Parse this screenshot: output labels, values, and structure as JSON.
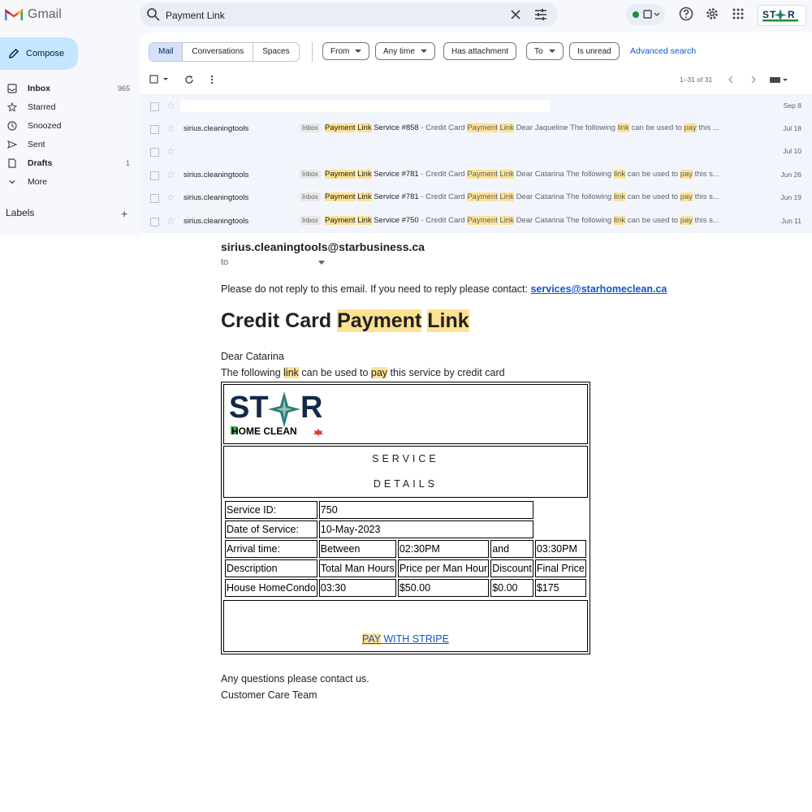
{
  "colors": {
    "accent": "#0b57d0",
    "compose_bg": "#c2e7ff",
    "highlight": "#fde293",
    "sidebar_bg": "#f6f8fc"
  },
  "header": {
    "app_name": "Gmail",
    "search_value": "Payment Link",
    "icons": [
      "search-icon",
      "close-icon",
      "tune-icon",
      "status-dot-icon",
      "help-icon",
      "gear-icon",
      "apps-icon"
    ]
  },
  "sidebar": {
    "compose_label": "Compose",
    "items": [
      {
        "label": "Inbox",
        "count": "965",
        "icon": "inbox-icon"
      },
      {
        "label": "Starred",
        "count": "",
        "icon": "star-icon"
      },
      {
        "label": "Snoozed",
        "count": "",
        "icon": "clock-icon"
      },
      {
        "label": "Sent",
        "count": "",
        "icon": "send-icon"
      },
      {
        "label": "Drafts",
        "count": "1",
        "icon": "draft-icon"
      },
      {
        "label": "More",
        "count": "",
        "icon": "chevron-down-icon"
      }
    ],
    "labels_title": "Labels"
  },
  "filters": {
    "segments": [
      "Mail",
      "Conversations",
      "Spaces"
    ],
    "chips": [
      "From",
      "Any time",
      "Has attachment",
      "To",
      "Is unread"
    ],
    "advanced_label": "Advanced search"
  },
  "toolbar": {
    "pager_text": "1–31 of 31"
  },
  "rows": [
    {
      "sender": "",
      "tag": "",
      "date": "Sep 8"
    },
    {
      "sender": "sirius.cleaningtools",
      "tag": "Inbox",
      "num": "#858",
      "name": "Jaqueline",
      "date": "Jul 18"
    },
    {
      "sender": "",
      "tag": "",
      "date": "Jul 10"
    },
    {
      "sender": "sirius.cleaningtools",
      "tag": "Inbox",
      "num": "#781",
      "name": "Catarina",
      "date": "Jun 26"
    },
    {
      "sender": "sirius.cleaningtools",
      "tag": "Inbox",
      "num": "#781",
      "name": "Catarina",
      "date": "Jun 19"
    },
    {
      "sender": "sirius.cleaningtools",
      "tag": "Inbox",
      "num": "#750",
      "name": "Catarina",
      "date": "Jun 11"
    }
  ],
  "snippet": {
    "w_payment": "Payment",
    "w_link": "Link",
    "w_service": "Service",
    "dash": "- Credit Card",
    "w_dear": "Dear",
    "w_the_following": "The following",
    "w_can_be": "can be used to",
    "w_pay": "pay",
    "tail_858": "this ...",
    "tail_other": "this s..."
  },
  "email": {
    "from": "sirius.cleaningtools@starbusiness.ca",
    "to_label": "to",
    "notice": "Please do not reply to this email. If you need to reply please contact:",
    "notice_email": "services@starhomeclean.ca",
    "title_a": "Credit Card",
    "title_b": "Payment",
    "title_c": "Link",
    "greeting": "Dear Catarina",
    "line_a": "The following",
    "line_link": "link",
    "line_b": "can be used to",
    "line_pay": "pay",
    "line_c": "this service by credit card",
    "logo_a": "ST",
    "logo_b": "R",
    "logo_sub": "HOME CLEAN",
    "service_line1": "SERVICE",
    "service_line2": "DETAILS",
    "service_id_label": "Service ID:",
    "service_id": "750",
    "date_label": "Date of Service:",
    "date": "10-May-2023",
    "arrival_label": "Arrival time:",
    "between": "Between",
    "time_start": "02:30PM",
    "and": "and",
    "time_end": "03:30PM",
    "col_desc": "Description",
    "col_hours": "Total Man Hours",
    "col_price": "Price per Man Hour",
    "col_discount": "Discount",
    "col_final": "Final Price",
    "desc": "House HomeCondo",
    "hours": "03:30",
    "price": "$50.00",
    "discount": "$0.00",
    "final": "$175",
    "pay_a": "PAY",
    "pay_b": "WITH STRIPE",
    "closing": "Any questions please contact us.",
    "signature": "Customer Care Team"
  }
}
